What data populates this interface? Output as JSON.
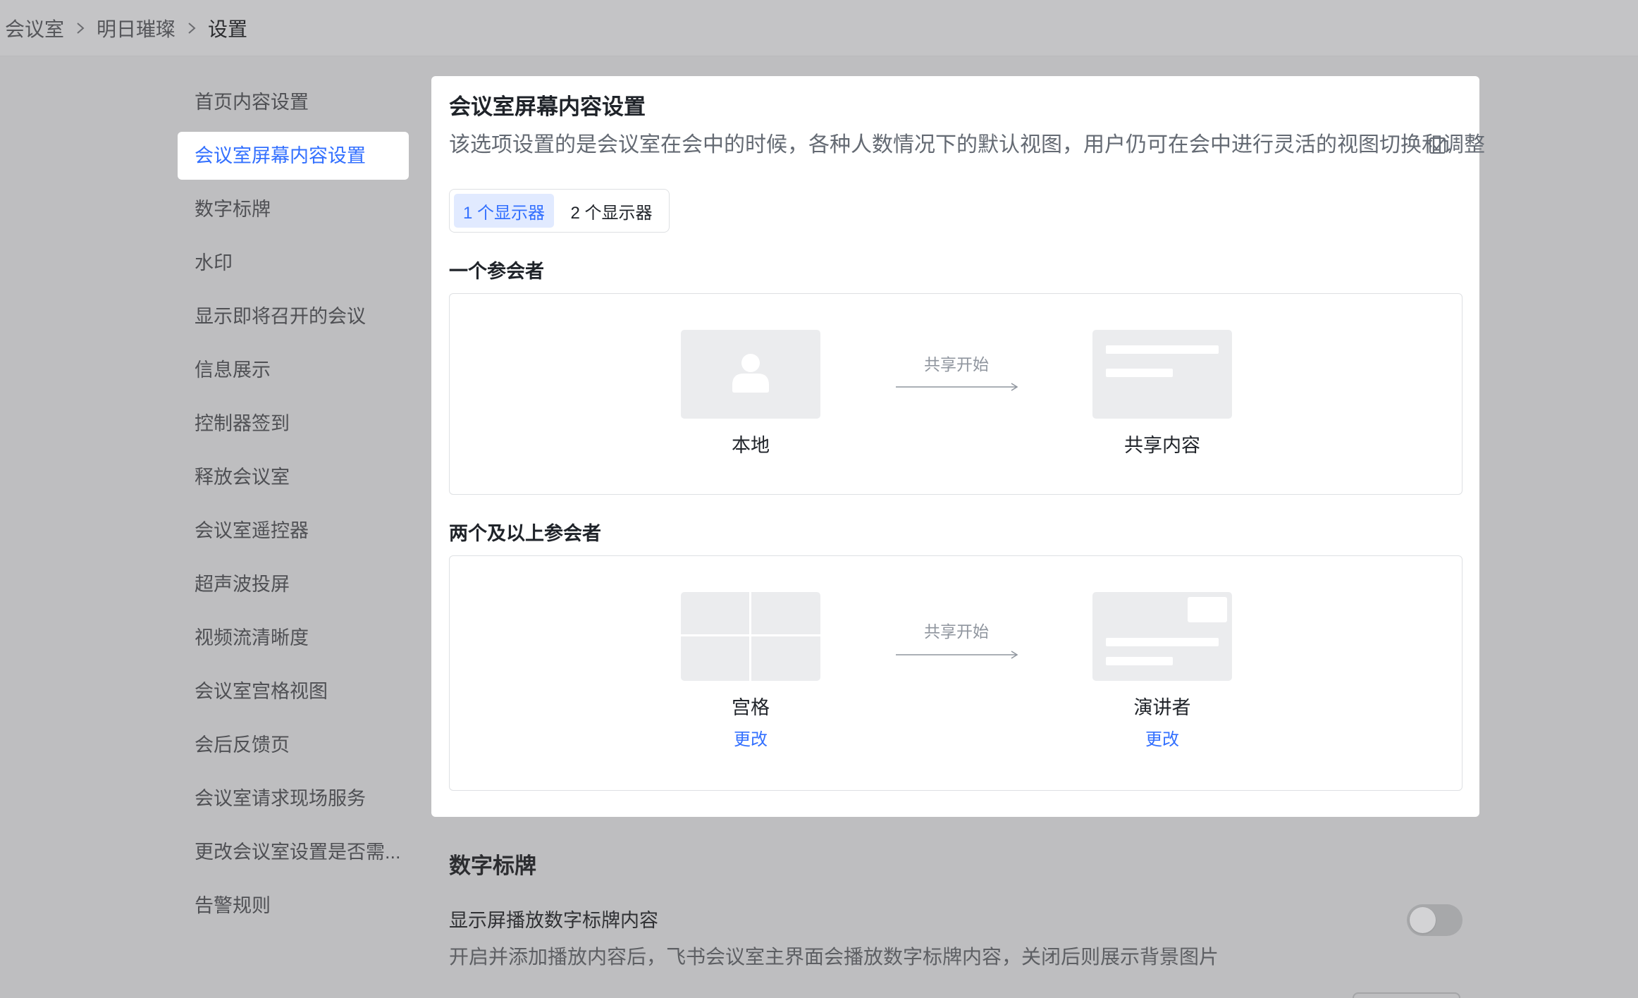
{
  "breadcrumb": {
    "items": [
      "会议室",
      "明日璀璨",
      "设置"
    ]
  },
  "sidebar": {
    "selected_index": 1,
    "items": [
      {
        "label": "首页内容设置"
      },
      {
        "label": "会议室屏幕内容设置"
      },
      {
        "label": "数字标牌"
      },
      {
        "label": "水印"
      },
      {
        "label": "显示即将召开的会议"
      },
      {
        "label": "信息展示"
      },
      {
        "label": "控制器签到"
      },
      {
        "label": "释放会议室"
      },
      {
        "label": "会议室遥控器"
      },
      {
        "label": "超声波投屏"
      },
      {
        "label": "视频流清晰度"
      },
      {
        "label": "会议室宫格视图"
      },
      {
        "label": "会后反馈页"
      },
      {
        "label": "会议室请求现场服务"
      },
      {
        "label": "更改会议室设置是否需..."
      },
      {
        "label": "告警规则"
      }
    ]
  },
  "screen_content": {
    "title": "会议室屏幕内容设置",
    "description": "该选项设置的是会议室在会中的时候，各种人数情况下的默认视图，用户仍可在会中进行灵活的视图切换和调整",
    "description_icon": "check-square-icon",
    "tabs": [
      {
        "label": "1 个显示器",
        "selected": true
      },
      {
        "label": "2 个显示器",
        "selected": false
      }
    ],
    "groups": [
      {
        "title": "一个参会者",
        "from": {
          "label": "本地",
          "thumbnail_icon": "person-icon"
        },
        "transition": "共享开始",
        "to": {
          "label": "共享内容",
          "thumbnail_icon": "shared-content-icon"
        }
      },
      {
        "title": "两个及以上参会者",
        "from": {
          "label": "宫格",
          "action": "更改",
          "thumbnail_icon": "grid-view-icon"
        },
        "transition": "共享开始",
        "to": {
          "label": "演讲者",
          "action": "更改",
          "thumbnail_icon": "speaker-view-icon"
        }
      }
    ]
  },
  "digital_signage": {
    "title": "数字标牌",
    "setting_label": "显示屏播放数字标牌内容",
    "enabled": false,
    "description": "开启并添加播放内容后，飞书会议室主界面会播放数字标牌内容，关闭后则展示背景图片"
  },
  "colors": {
    "accent": "#3370ff",
    "selected_tab_bg": "#e1eaff",
    "page_mask": "#bebec0",
    "card_bg": "#ffffff",
    "thumbnail_bg": "#ebecee",
    "muted_text": "#8f959e"
  }
}
